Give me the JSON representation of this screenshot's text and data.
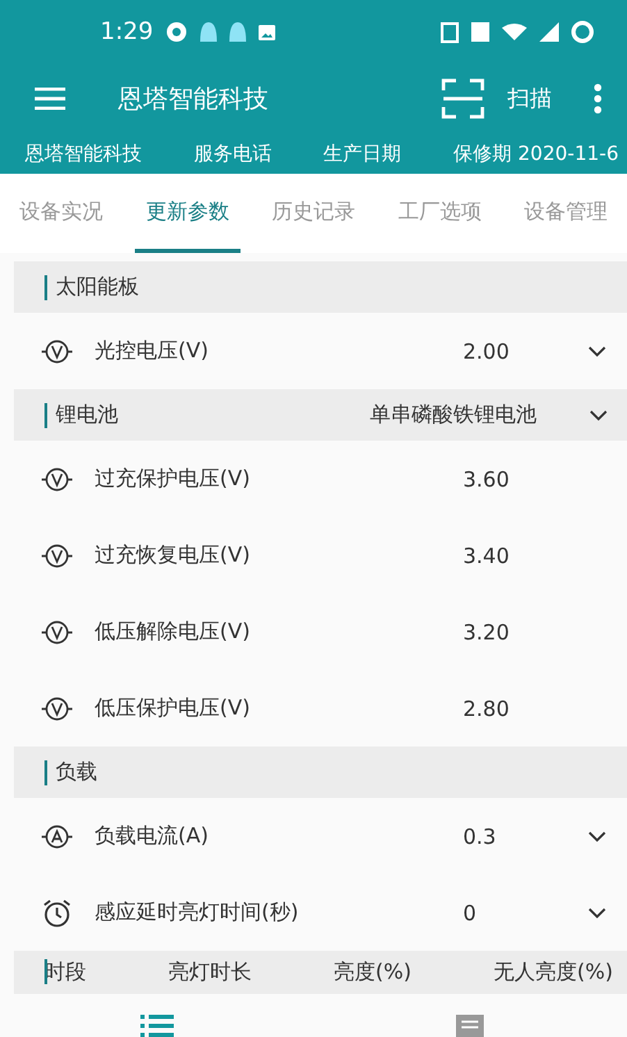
{
  "status_bar": {
    "time": "1:29"
  },
  "toolbar": {
    "title": "恩塔智能科技",
    "scan_label": "扫描"
  },
  "info_strip": [
    "恩塔智能科技",
    "服务电话",
    "生产日期",
    "保修期 2020-11-6"
  ],
  "tabs": [
    {
      "label": "设备实况",
      "selected": false
    },
    {
      "label": "更新参数",
      "selected": true
    },
    {
      "label": "历史记录",
      "selected": false
    },
    {
      "label": "工厂选项",
      "selected": false
    },
    {
      "label": "设备管理",
      "selected": false
    }
  ],
  "sections": [
    {
      "title": "太阳能板",
      "rows": [
        {
          "kind": "volt",
          "label": "光控电压(V)",
          "value": "2.00",
          "dropdown": true
        }
      ]
    },
    {
      "title": "锂电池",
      "value": "单串磷酸铁锂电池",
      "dropdown": true,
      "rows": [
        {
          "kind": "volt",
          "label": "过充保护电压(V)",
          "value": "3.60",
          "dropdown": false
        },
        {
          "kind": "volt",
          "label": "过充恢复电压(V)",
          "value": "3.40",
          "dropdown": false
        },
        {
          "kind": "volt",
          "label": "低压解除电压(V)",
          "value": "3.20",
          "dropdown": false
        },
        {
          "kind": "volt",
          "label": "低压保护电压(V)",
          "value": "2.80",
          "dropdown": false
        }
      ]
    },
    {
      "title": "负载",
      "rows": [
        {
          "kind": "amp",
          "label": "负载电流(A)",
          "value": "0.3",
          "dropdown": true
        },
        {
          "kind": "clock",
          "label": "感应延时亮灯时间(秒)",
          "value": "0",
          "dropdown": true
        }
      ]
    }
  ],
  "table": {
    "columns": [
      "时段",
      "亮灯时长",
      "亮度(%)",
      "无人亮度(%)"
    ]
  },
  "bottom_nav": [
    {
      "kind": "list",
      "selected": true
    },
    {
      "kind": "message",
      "selected": false
    }
  ]
}
